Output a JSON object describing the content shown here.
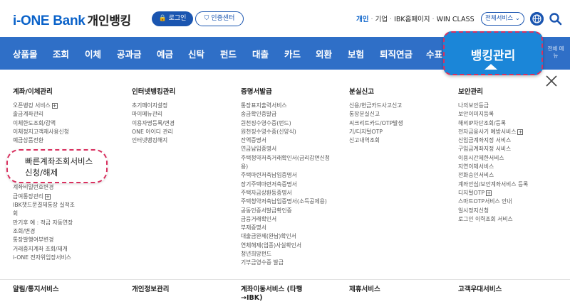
{
  "header": {
    "logo_brand": "i-ONE Bank",
    "logo_sub": "개인뱅킹",
    "login_label": "🔒 로그인",
    "cert_label": "⛉ 인증센터",
    "util_links": [
      "개인",
      "기업",
      "IBK홈페이지",
      "WIN CLASS"
    ],
    "all_services_label": "전체서비스 ⌄",
    "icons": [
      "globe-icon",
      "search-icon"
    ]
  },
  "nav": {
    "items": [
      "상품몰",
      "조회",
      "이체",
      "공과금",
      "예금",
      "신탁",
      "펀드",
      "대출",
      "카드",
      "외환",
      "보험",
      "퇴직연금",
      "수표",
      "뱅킹관리"
    ],
    "side_menu_label": "전체 메뉴",
    "highlight_label": "뱅킹관리"
  },
  "menu": {
    "columns": [
      {
        "title": "계좌/이체관리",
        "items": [
          "오픈뱅킹 서비스",
          "출금계좌관리",
          "이체한도조회/감액",
          "이체정지고객재사용신청",
          "예금상품전환",
          "빠른계좌조회서비스 신청/해제",
          "계좌비밀번호변경",
          "급여통장관리",
          "IBK챗드문결제통장 실적조회",
          "만기후 예 : 적금 자동연장 조회/변경",
          "통장발행여부변경",
          "거래중지계좌 조회/재개",
          "i-ONE 전자위임장서비스"
        ],
        "plus_after": [
          "오픈뱅킹 서비스",
          "급여통장관리"
        ]
      },
      {
        "title": "인터넷뱅킹관리",
        "items": [
          "초기페이지설정",
          "마이메뉴관리",
          "이용자명등록/변경",
          "ONE 아이디 관리",
          "인터넷뱅킹해지"
        ]
      },
      {
        "title": "증명서발급",
        "items": [
          "통장표지출력서비스",
          "송금확인증발급",
          "원천징수영수증(펀드)",
          "원천징수영수증(신양식)",
          "잔액증명서",
          "연금납입증명서",
          "주택청약저축거래확인서(금리감면신청용)",
          "주택마련저축납입증명서",
          "장기주택마련저축증명서",
          "주택자금상환등증명서",
          "주택청약저축납입증명서(소득공제용)",
          "공동인증서발급확인증",
          "금융거래확인서",
          "부재증명서",
          "대출금완제(완납)확인서",
          "연체해제(업종)사실확인서",
          "청년희망펀드",
          "기부금영수증 발급"
        ]
      },
      {
        "title": "분실신고",
        "items": [
          "신용/현금카드사고신고",
          "통장분실신고",
          "씨크리트카드/OTP발생기/디지털OTP",
          "신고내역조회"
        ]
      },
      {
        "title": "보안관리",
        "items": [
          "나의보안등급",
          "보안이미지등록",
          "해외IP차단조회/등록",
          "전자금융사기 예방서비스",
          "신입금계좌지정 서비스",
          "구입금계좌지정 서비스",
          "이용시간제한서비스",
          "지연이체서비스",
          "전화승인서비스",
          "계좌안심/보안계좌서비스 등록",
          "디지털OTP",
          "스마트OTP서비스 안내",
          "일시정지신청",
          "로그인 이력조회 서비스"
        ],
        "plus_after": [
          "전자금융사기 예방서비스",
          "디지털OTP"
        ]
      }
    ],
    "bottom_titles": [
      "알림/통지서비스",
      "개인정보관리",
      "계좌이동서비스 (타행→IBK)",
      "제휴서비스",
      "고객우대서비스"
    ],
    "quick_highlight": [
      "빠른계좌조회서비스",
      "신청/해제"
    ]
  }
}
